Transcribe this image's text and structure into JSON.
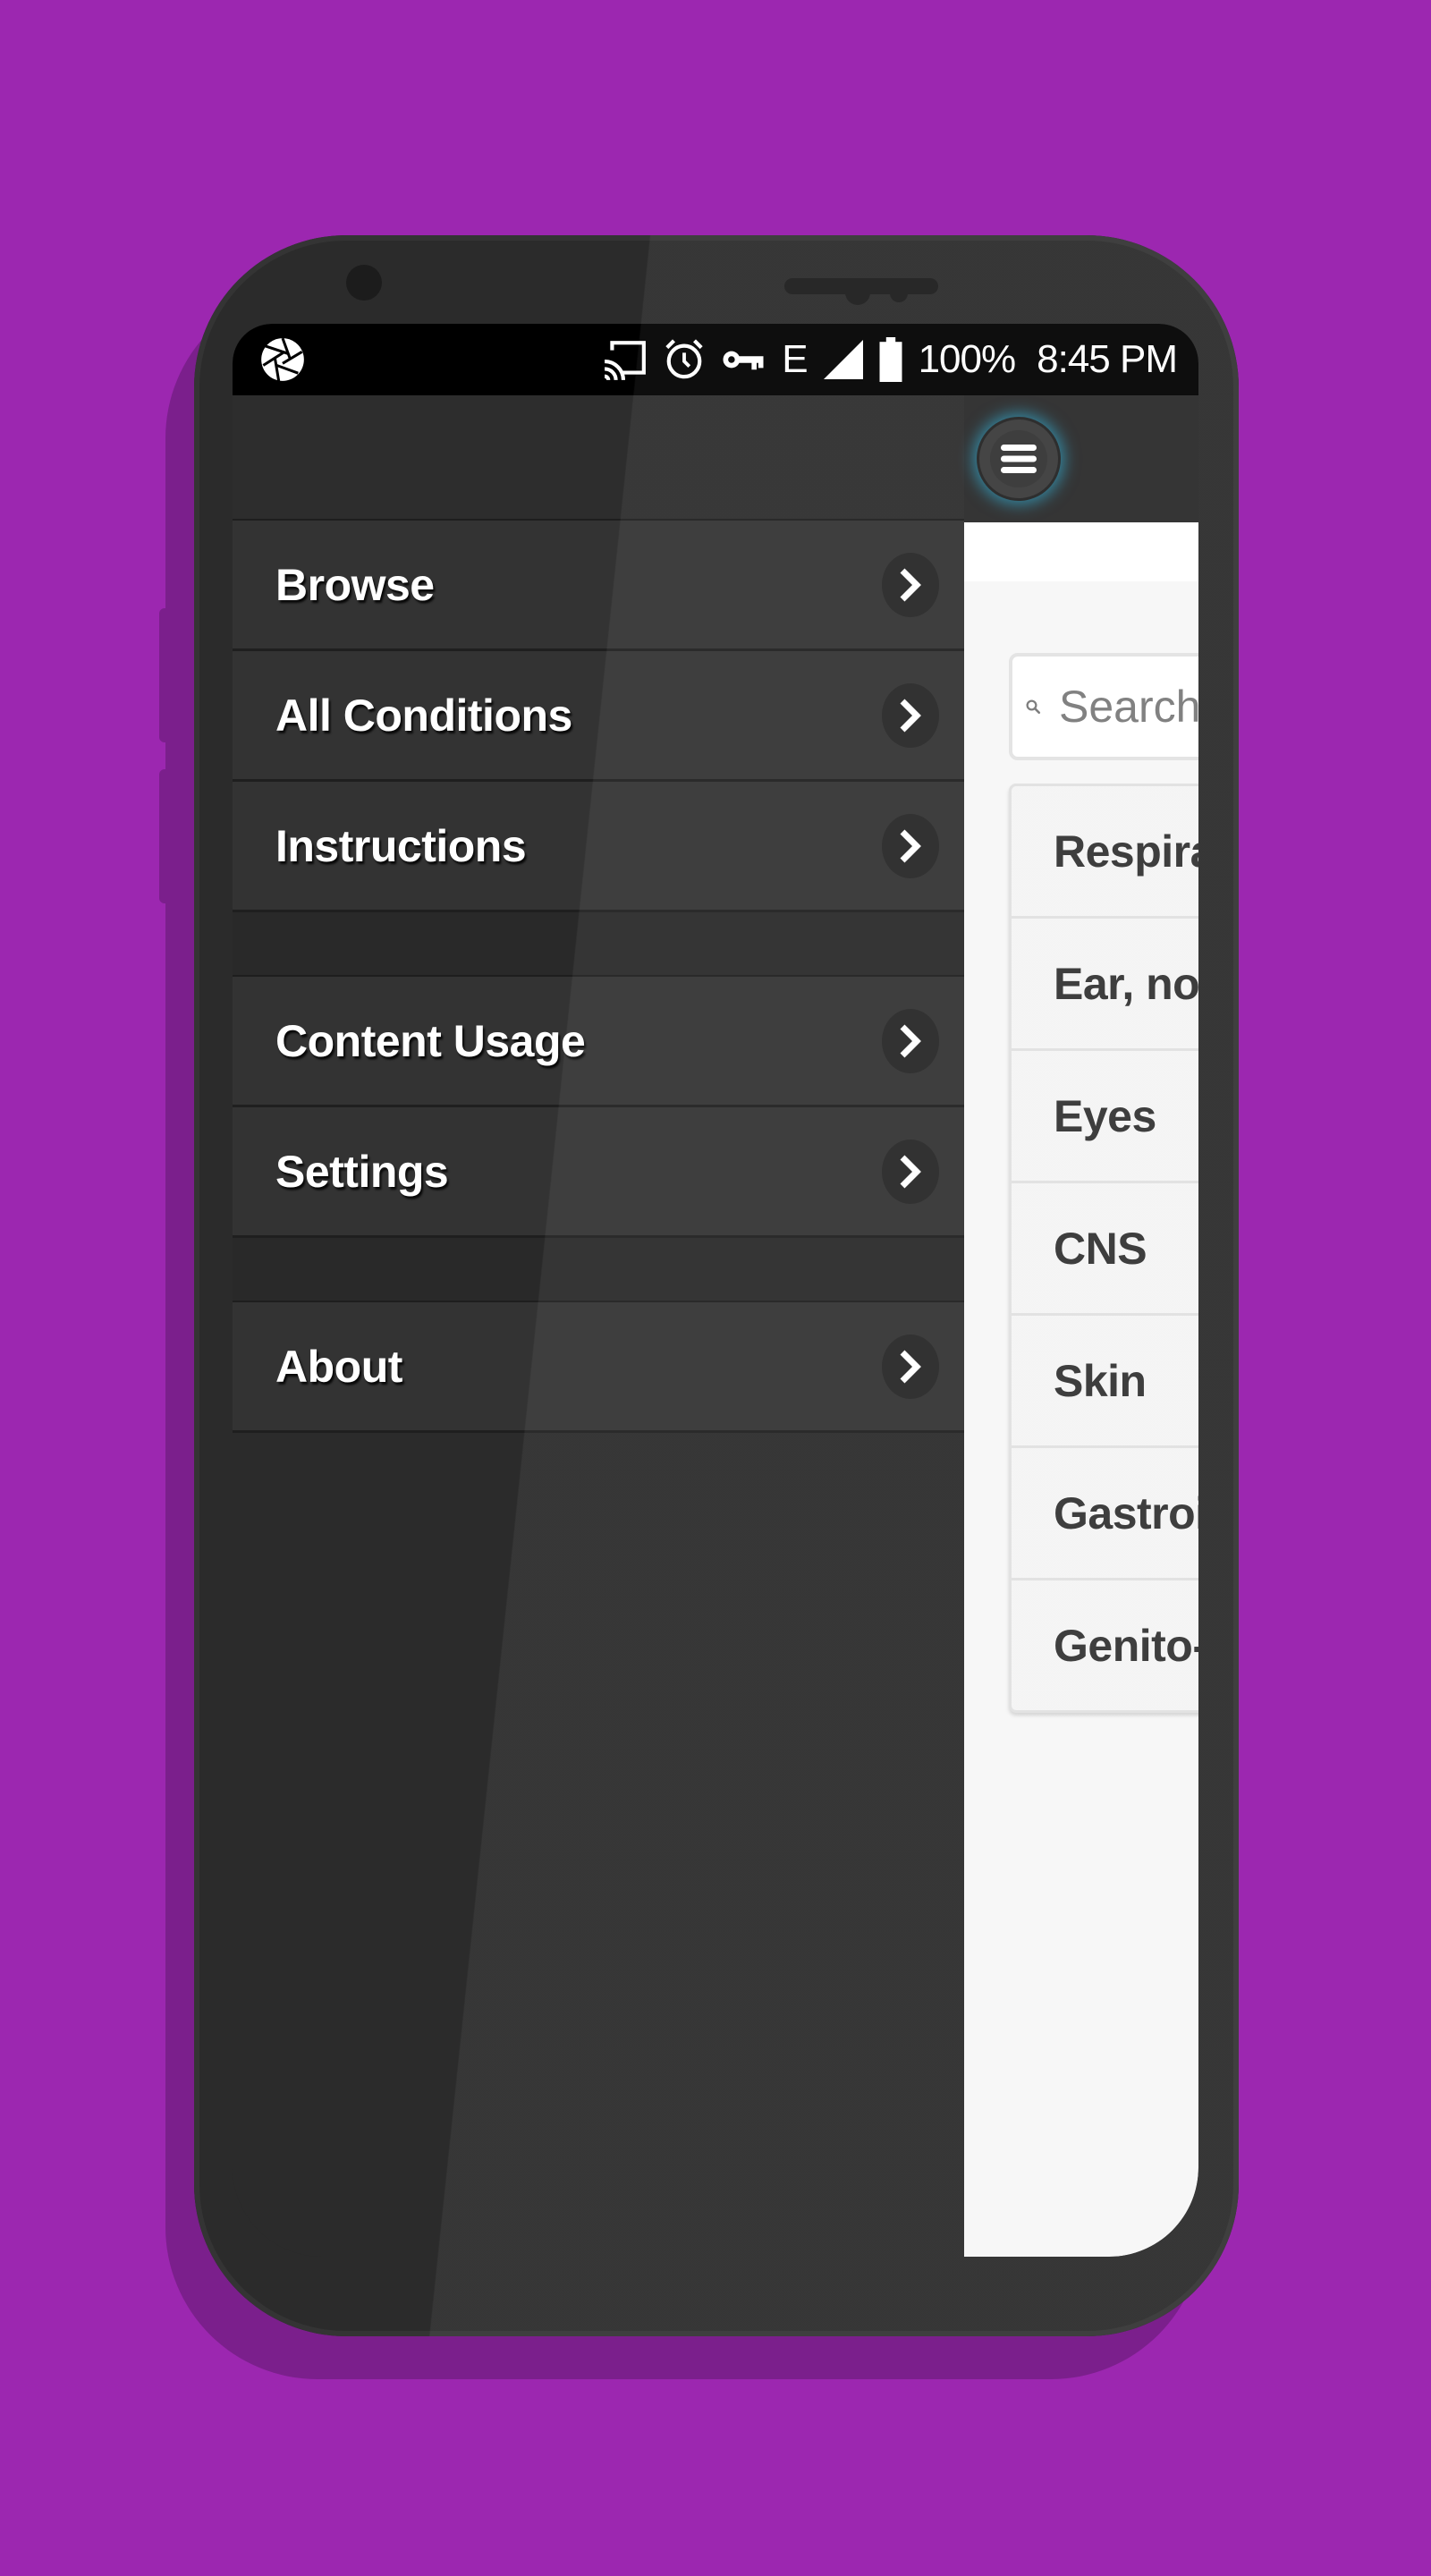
{
  "status_bar": {
    "left_icon": "camera-aperture-icon",
    "icons": [
      "cast-icon",
      "alarm-clock-icon",
      "vpn-key-icon",
      "edge-network-icon",
      "signal-icon",
      "battery-icon"
    ],
    "network_label": "E",
    "battery": "100%",
    "time": "8:45 PM"
  },
  "drawer": {
    "groups": [
      {
        "items": [
          {
            "label": "Browse",
            "icon": "chevron-right-icon"
          },
          {
            "label": "All Conditions",
            "icon": "chevron-right-icon"
          },
          {
            "label": "Instructions",
            "icon": "chevron-right-icon"
          }
        ]
      },
      {
        "items": [
          {
            "label": "Content Usage",
            "icon": "chevron-right-icon"
          },
          {
            "label": "Settings",
            "icon": "chevron-right-icon"
          }
        ]
      },
      {
        "items": [
          {
            "label": "About",
            "icon": "chevron-right-icon"
          }
        ]
      }
    ]
  },
  "toolbar": {
    "menu_icon": "hamburger-menu-icon"
  },
  "search": {
    "placeholder": "Search",
    "value": ""
  },
  "categories": [
    "Respiratory",
    "Ear, nose",
    "Eyes",
    "CNS",
    "Skin",
    "Gastrointestinal",
    "Genito-"
  ],
  "colors": {
    "background": "#9c27b0",
    "phone_body": "#2b2b2b",
    "accent_glow": "#28aad2",
    "menu_text": "#ffffff",
    "list_text": "#333333"
  }
}
